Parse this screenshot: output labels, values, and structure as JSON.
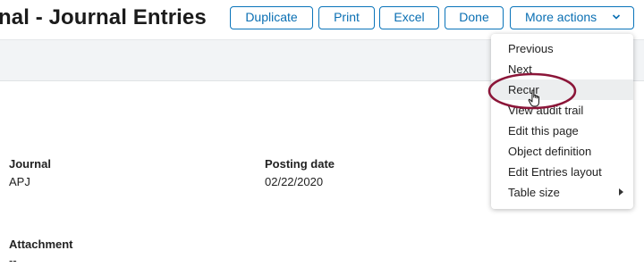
{
  "header": {
    "title": "nal - Journal Entries",
    "buttons": {
      "duplicate": "Duplicate",
      "print": "Print",
      "excel": "Excel",
      "done": "Done",
      "more_actions": "More actions"
    }
  },
  "fields": {
    "journal_label": "Journal",
    "journal_value": "APJ",
    "posting_date_label": "Posting date",
    "posting_date_value": "02/22/2020",
    "attachment_label": "Attachment",
    "attachment_value": "--"
  },
  "more_menu": {
    "items": [
      {
        "label": "Previous"
      },
      {
        "label": "Next"
      },
      {
        "label": "Recur"
      },
      {
        "label": "View audit trail"
      },
      {
        "label": "Edit this page"
      },
      {
        "label": "Object definition"
      },
      {
        "label": "Edit Entries layout"
      },
      {
        "label": "Table size"
      }
    ],
    "hovered_item": "Recur"
  },
  "colors": {
    "accent": "#0a74ba",
    "highlight_ellipse": "#8b1538",
    "bar_background": "#f2f4f6",
    "menu_hover": "#eceeef"
  },
  "icons": {
    "more_actions_chevron": "chevron-down-icon",
    "table_size_submenu": "caret-right-icon",
    "cursor": "hand-pointer-icon"
  }
}
